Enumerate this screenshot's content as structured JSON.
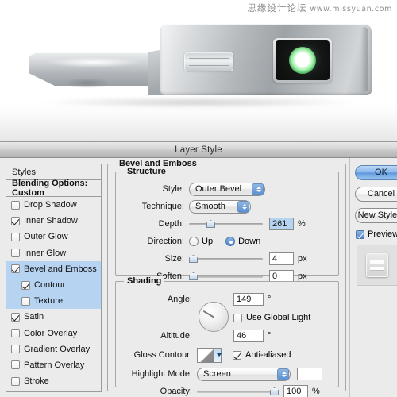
{
  "watermark": {
    "cn": "思缘设计论坛",
    "url": "www.missyuan.com"
  },
  "photo": {
    "alt_name": "metallic-usb-device-with-green-led"
  },
  "dialog": {
    "title": "Layer Style",
    "styles_panel": {
      "header": "Styles",
      "blending_options": "Blending Options: Custom",
      "items": [
        {
          "label": "Drop Shadow",
          "checked": false,
          "selected": false,
          "indent": false
        },
        {
          "label": "Inner Shadow",
          "checked": true,
          "selected": false,
          "indent": false
        },
        {
          "label": "Outer Glow",
          "checked": false,
          "selected": false,
          "indent": false
        },
        {
          "label": "Inner Glow",
          "checked": false,
          "selected": false,
          "indent": false
        },
        {
          "label": "Bevel and Emboss",
          "checked": true,
          "selected": true,
          "indent": false
        },
        {
          "label": "Contour",
          "checked": true,
          "selected": true,
          "indent": true
        },
        {
          "label": "Texture",
          "checked": false,
          "selected": true,
          "indent": true
        },
        {
          "label": "Satin",
          "checked": true,
          "selected": false,
          "indent": false
        },
        {
          "label": "Color Overlay",
          "checked": false,
          "selected": false,
          "indent": false
        },
        {
          "label": "Gradient Overlay",
          "checked": false,
          "selected": false,
          "indent": false
        },
        {
          "label": "Pattern Overlay",
          "checked": false,
          "selected": false,
          "indent": false
        },
        {
          "label": "Stroke",
          "checked": false,
          "selected": false,
          "indent": false
        }
      ]
    },
    "bevel_group": {
      "legend": "Bevel and Emboss",
      "structure": {
        "legend": "Structure",
        "style_label": "Style:",
        "style_value": "Outer Bevel",
        "technique_label": "Technique:",
        "technique_value": "Smooth",
        "depth_label": "Depth:",
        "depth_value": "261",
        "depth_unit": "%",
        "direction_label": "Direction:",
        "direction_up": "Up",
        "direction_down": "Down",
        "direction_selected": "Down",
        "size_label": "Size:",
        "size_value": "4",
        "size_unit": "px",
        "soften_label": "Soften:",
        "soften_value": "0",
        "soften_unit": "px"
      },
      "shading": {
        "legend": "Shading",
        "angle_label": "Angle:",
        "angle_value": "149",
        "angle_unit": "°",
        "use_global_light": "Use Global Light",
        "use_global_light_checked": false,
        "altitude_label": "Altitude:",
        "altitude_value": "46",
        "altitude_unit": "°",
        "gloss_contour_label": "Gloss Contour:",
        "anti_aliased": "Anti-aliased",
        "anti_aliased_checked": true,
        "highlight_mode_label": "Highlight Mode:",
        "highlight_mode_value": "Screen",
        "highlight_color": "#ffffff",
        "opacity_label": "Opacity:",
        "opacity_value": "100",
        "opacity_unit": "%"
      }
    },
    "buttons": {
      "ok": "OK",
      "cancel": "Cancel",
      "new_style": "New Style...",
      "preview": "Preview",
      "preview_checked": true
    }
  },
  "colors": {
    "accent": "#5e97dc",
    "selection": "#b6d3f2",
    "dialog_bg": "#ebebeb",
    "led_green": "#3aa84f"
  }
}
